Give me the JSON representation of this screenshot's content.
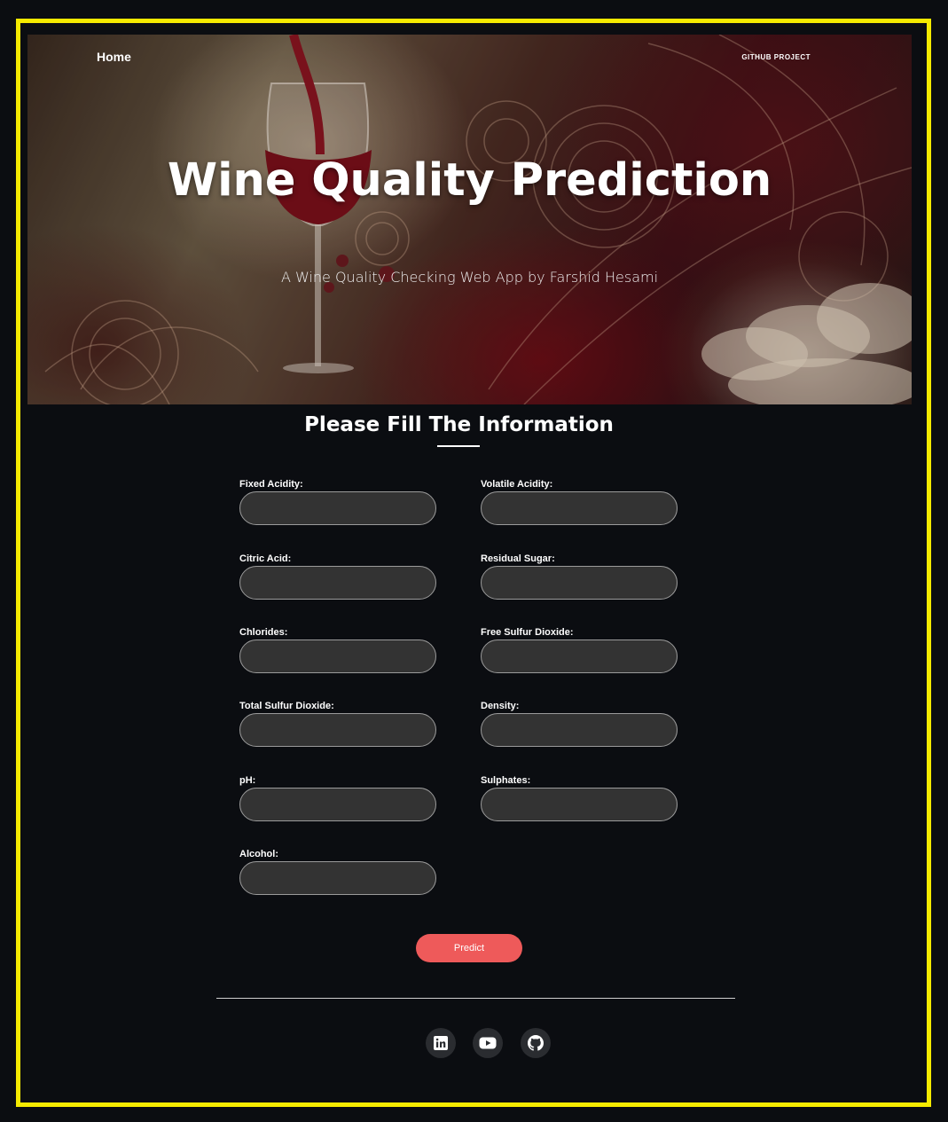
{
  "nav": {
    "home_label": "Home",
    "github_label": "GITHUB PROJECT"
  },
  "hero": {
    "title": "Wine Quality Prediction",
    "subtitle": "A Wine Quality Checking Web App by Farshid Hesami"
  },
  "form": {
    "title": "Please Fill The Information",
    "fields": [
      {
        "label": "Fixed Acidity:",
        "value": ""
      },
      {
        "label": "Volatile Acidity:",
        "value": ""
      },
      {
        "label": "Citric Acid:",
        "value": ""
      },
      {
        "label": "Residual Sugar:",
        "value": ""
      },
      {
        "label": "Chlorides:",
        "value": ""
      },
      {
        "label": "Free Sulfur Dioxide:",
        "value": ""
      },
      {
        "label": "Total Sulfur Dioxide:",
        "value": ""
      },
      {
        "label": "Density:",
        "value": ""
      },
      {
        "label": "pH:",
        "value": ""
      },
      {
        "label": "Sulphates:",
        "value": ""
      },
      {
        "label": "Alcohol:",
        "value": ""
      }
    ],
    "submit_label": "Predict"
  },
  "footer": {
    "social": [
      {
        "icon": "linkedin-icon"
      },
      {
        "icon": "youtube-icon"
      },
      {
        "icon": "github-icon"
      }
    ]
  },
  "colors": {
    "frame_border": "#f5ea00",
    "background": "#0b0d11",
    "button": "#ee5a5a",
    "input_bg": "#333333"
  }
}
